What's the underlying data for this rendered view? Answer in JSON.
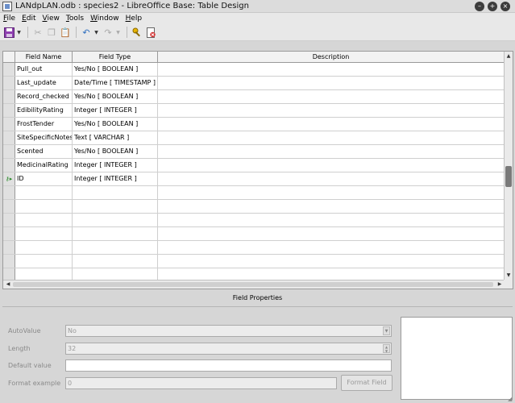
{
  "window": {
    "title": "LANdpLAN.odb : species2 - LibreOffice Base: Table Design"
  },
  "menu": [
    {
      "key": "F",
      "rest": "ile"
    },
    {
      "key": "E",
      "rest": "dit"
    },
    {
      "key": "V",
      "rest": "iew"
    },
    {
      "key": "T",
      "rest": "ools"
    },
    {
      "key": "W",
      "rest": "indow"
    },
    {
      "key": "H",
      "rest": "elp"
    }
  ],
  "toolbar": {
    "icons": [
      "save-icon",
      "cut-icon",
      "copy-icon",
      "paste-icon",
      "undo-icon",
      "redo-icon",
      "primary-key-icon",
      "index-design-icon"
    ]
  },
  "grid": {
    "columns": [
      "Field Name",
      "Field Type",
      "Description"
    ],
    "rows": [
      {
        "name": "Pull_out",
        "type": "Yes/No [ BOOLEAN ]",
        "description": ""
      },
      {
        "name": "Last_update",
        "type": "Date/Time [ TIMESTAMP ]",
        "description": ""
      },
      {
        "name": "Record_checked",
        "type": "Yes/No [ BOOLEAN ]",
        "description": ""
      },
      {
        "name": "EdibilityRating",
        "type": "Integer [ INTEGER ]",
        "description": ""
      },
      {
        "name": "FrostTender",
        "type": "Yes/No [ BOOLEAN ]",
        "description": ""
      },
      {
        "name": "SiteSpecificNotes",
        "type": "Text [ VARCHAR ]",
        "description": ""
      },
      {
        "name": "Scented",
        "type": "Yes/No [ BOOLEAN ]",
        "description": ""
      },
      {
        "name": "MedicinalRating",
        "type": "Integer [ INTEGER ]",
        "description": ""
      },
      {
        "name": "ID",
        "type": "Integer [ INTEGER ]",
        "description": "",
        "marker": "⚷▸"
      },
      {
        "name": "",
        "type": "",
        "description": ""
      },
      {
        "name": "",
        "type": "",
        "description": ""
      },
      {
        "name": "",
        "type": "",
        "description": ""
      },
      {
        "name": "",
        "type": "",
        "description": ""
      },
      {
        "name": "",
        "type": "",
        "description": ""
      },
      {
        "name": "",
        "type": "",
        "description": ""
      },
      {
        "name": "",
        "type": "",
        "description": ""
      }
    ]
  },
  "field_properties": {
    "heading": "Field Properties",
    "auto_value": {
      "label": "AutoValue",
      "value": "No"
    },
    "length": {
      "label": "Length",
      "value": "32"
    },
    "default_value": {
      "label": "Default value",
      "value": ""
    },
    "format_example": {
      "label": "Format example",
      "value": "0",
      "button": "Format Field"
    }
  }
}
